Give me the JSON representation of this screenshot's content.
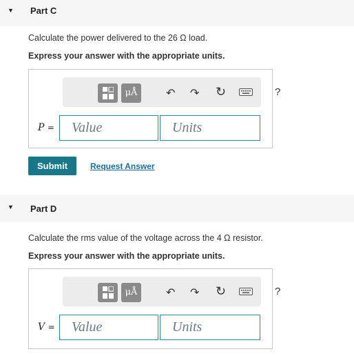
{
  "parts": [
    {
      "title": "Part C",
      "question": "Calculate the power delivered to the 26 Ω load.",
      "instruction": "Express your answer with the appropriate units.",
      "variable": "P",
      "equals": "=",
      "value_placeholder": "Value",
      "units_placeholder": "Units"
    },
    {
      "title": "Part D",
      "question": "Calculate the rms value of the voltage across the 4 Ω resistor.",
      "instruction": "Express your answer with the appropriate units.",
      "variable": "V",
      "equals": "=",
      "value_placeholder": "Value",
      "units_placeholder": "Units"
    }
  ],
  "toolbar": {
    "units_btn_label": "μÅ",
    "undo_glyph": "↶",
    "redo_glyph": "↷",
    "reset_glyph": "↻",
    "help_label": "?"
  },
  "actions": {
    "submit_label": "Submit",
    "request_label": "Request Answer"
  },
  "icons": [
    "collapse-triangle-icon",
    "templates-icon",
    "units-icon",
    "undo-icon",
    "redo-icon",
    "reset-icon",
    "keyboard-icon",
    "help-icon"
  ],
  "colors": {
    "accent": "#19778a",
    "link": "#1b6fa0",
    "field_border": "#2a8a96"
  }
}
